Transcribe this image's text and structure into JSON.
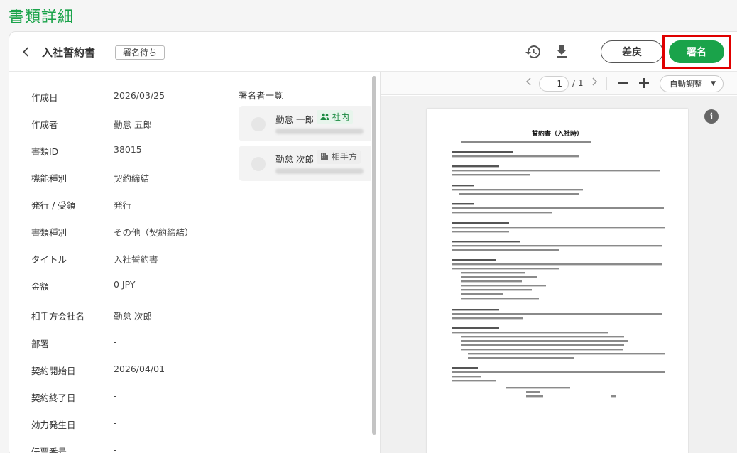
{
  "page": {
    "title": "書類詳細"
  },
  "header": {
    "back_icon": "chevron-left-icon",
    "doc_title": "入社誓約書",
    "status": "署名待ち",
    "history_icon": "history-icon",
    "download_icon": "download-icon",
    "return_label": "差戻",
    "sign_label": "署名",
    "sign_highlight_color": "#e00000",
    "accent_color": "#1aa34a"
  },
  "details": [
    {
      "label": "作成日",
      "value": "2026/03/25"
    },
    {
      "label": "作成者",
      "value": "勤怠 五郎"
    },
    {
      "label": "書類ID",
      "value": "38015"
    },
    {
      "label": "機能種別",
      "value": "契約締結"
    },
    {
      "label": "発行 / 受領",
      "value": "発行"
    },
    {
      "label": "書類種別",
      "value": "その他（契約締結）"
    },
    {
      "label": "タイトル",
      "value": "入社誓約書"
    },
    {
      "label": "金額",
      "value": "0 JPY"
    },
    {
      "label": "相手方会社名",
      "value": "勤怠 次郎"
    },
    {
      "label": "部署",
      "value": "-"
    },
    {
      "label": "契約開始日",
      "value": "2026/04/01"
    },
    {
      "label": "契約終了日",
      "value": "-"
    },
    {
      "label": "効力発生日",
      "value": "-"
    },
    {
      "label": "伝票番号",
      "value": "-"
    }
  ],
  "signers": {
    "title": "署名者一覧",
    "items": [
      {
        "name": "勤怠 一郎",
        "tag": "社内",
        "tag_icon": "users-icon"
      },
      {
        "name": "勤怠 次郎",
        "tag": "相手方",
        "tag_icon": "building-icon"
      }
    ]
  },
  "viewer": {
    "current_page": "1",
    "total_pages": "/ 1",
    "zoom_label": "自動調整",
    "pdf_title": "誓約書（入社時）",
    "info_icon": "info-icon"
  }
}
